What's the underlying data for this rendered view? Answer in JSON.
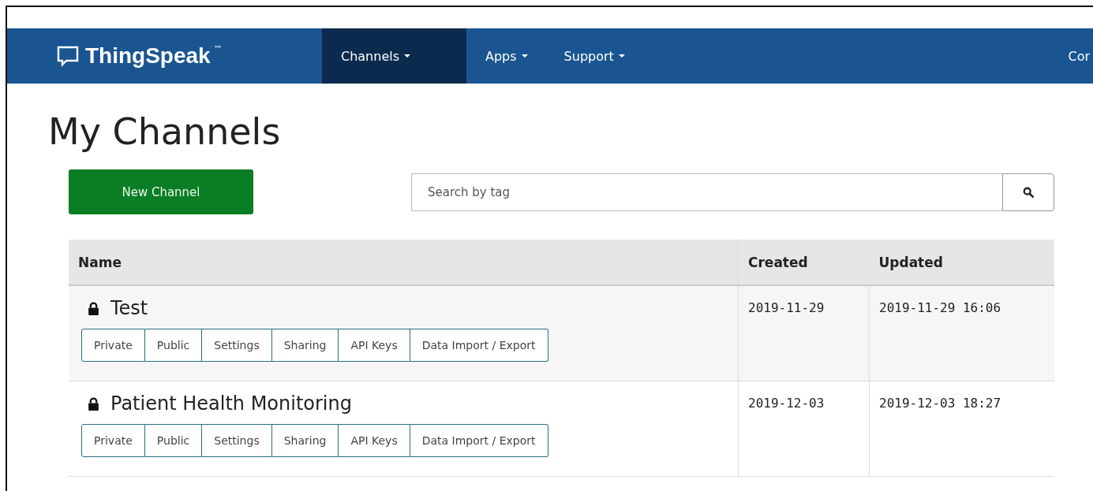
{
  "navbar": {
    "brand": "ThingSpeak",
    "trademark": "™",
    "menus": [
      {
        "label": "Channels",
        "selected": true
      },
      {
        "label": "Apps",
        "selected": false
      },
      {
        "label": "Support",
        "selected": false
      }
    ],
    "right_link": "Cor"
  },
  "heading": "My Channels",
  "new_channel_button": "New Channel",
  "search": {
    "placeholder": "Search by tag"
  },
  "table": {
    "columns": [
      "Name",
      "Created",
      "Updated"
    ],
    "rows": [
      {
        "name": "Test",
        "locked": true,
        "created": "2019-11-29",
        "updated": "2019-11-29 16:06",
        "actions": [
          "Private",
          "Public",
          "Settings",
          "Sharing",
          "API Keys",
          "Data Import / Export"
        ]
      },
      {
        "name": "Patient Health Monitoring",
        "locked": true,
        "created": "2019-12-03",
        "updated": "2019-12-03 18:27",
        "actions": [
          "Private",
          "Public",
          "Settings",
          "Sharing",
          "API Keys",
          "Data Import / Export"
        ]
      }
    ]
  }
}
